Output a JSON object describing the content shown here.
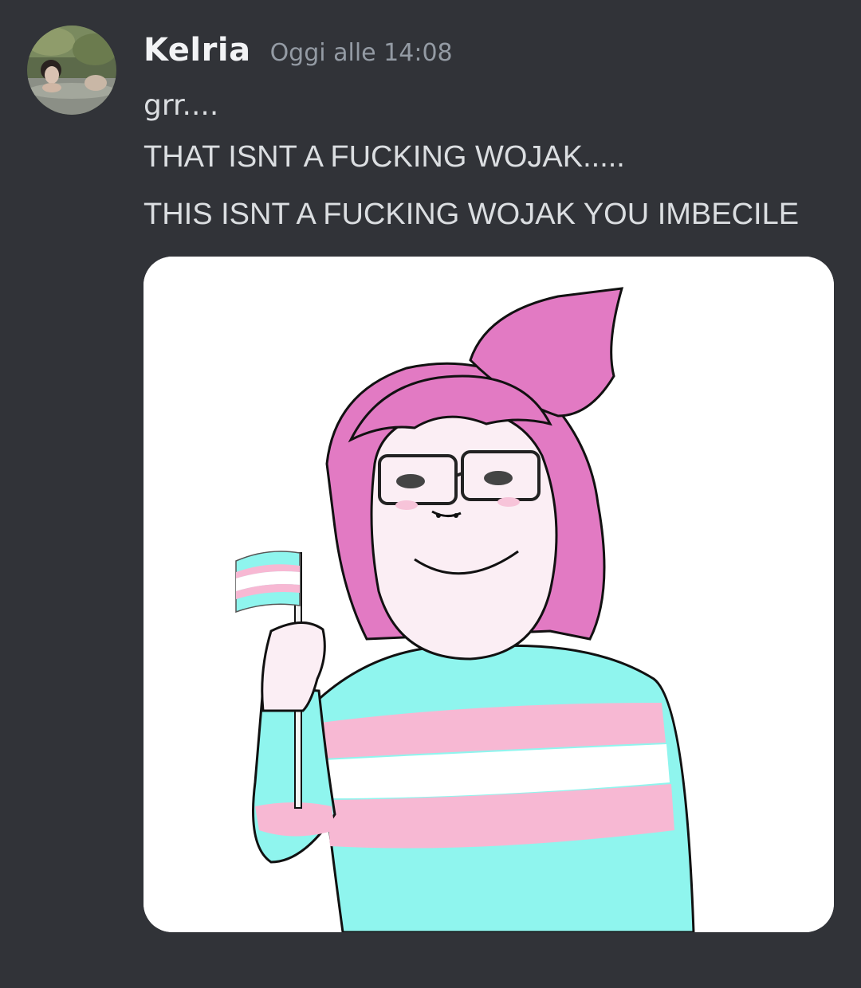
{
  "message": {
    "author": "Kelria",
    "timestamp": "Oggi alle 14:08",
    "lines": [
      "grr....",
      "THAT ISNT A FUCKING WOJAK.....",
      "THIS ISNT A FUCKING WOJAK YOU IMBECILE"
    ]
  },
  "colors": {
    "background": "#313338",
    "username": "#f2f3f5",
    "timestamp": "#949ba4",
    "text": "#dbdee1",
    "hair": "#e27ac3",
    "sweater_blue": "#8ff5ee",
    "sweater_pink": "#f7b8d3",
    "skin": "#fbeef4"
  }
}
